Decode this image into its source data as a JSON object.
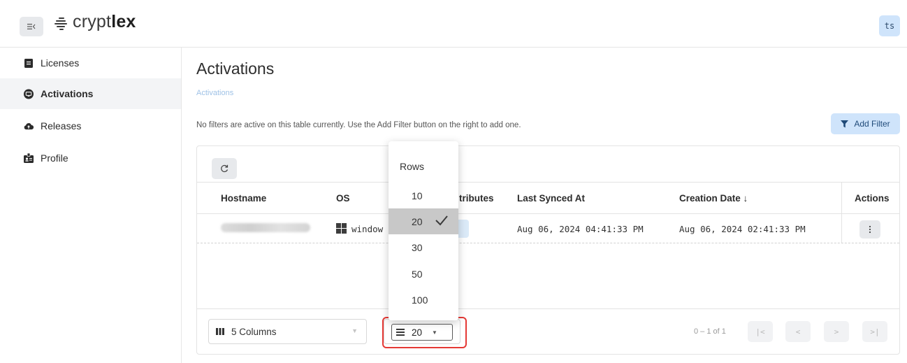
{
  "header": {
    "menu_icon": "collapse-sidebar-icon",
    "logo_prefix": "crypt",
    "logo_bold": "lex",
    "avatar_initials": "ts"
  },
  "sidebar": {
    "items": [
      {
        "label": "Licenses",
        "icon": "document-icon",
        "active": false
      },
      {
        "label": "Activations",
        "icon": "activations-icon",
        "active": true
      },
      {
        "label": "Releases",
        "icon": "cloud-upload-icon",
        "active": false
      },
      {
        "label": "Profile",
        "icon": "id-badge-icon",
        "active": false
      }
    ]
  },
  "main": {
    "title": "Activations",
    "breadcrumb": "Activations",
    "filter_message": "No filters are active on this table currently. Use the Add Filter button on the right to add one.",
    "add_filter_label": "Add Filter"
  },
  "table": {
    "columns": [
      "Hostname",
      "OS",
      "tributes",
      "Last Synced At",
      "Creation Date ↓",
      "Actions"
    ],
    "rows": [
      {
        "hostname_blurred": true,
        "os": "window",
        "last_synced": "Aug 06, 2024 04:41:33 PM",
        "created": "Aug 06, 2024 02:41:33 PM",
        "actions_icon": "more-vertical-icon"
      }
    ]
  },
  "footer": {
    "columns_label": "5 Columns",
    "rows_value": "20",
    "pagination_text": "0 – 1 of 1",
    "pager_buttons": [
      "|<",
      "<",
      ">",
      ">|"
    ]
  },
  "rows_menu": {
    "heading": "Rows",
    "options": [
      "10",
      "20",
      "30",
      "50",
      "100"
    ],
    "selected": "20"
  },
  "colors": {
    "accent_light": "#cfe4fb",
    "highlight_border": "#e53935",
    "selected_option_bg": "#c8c8c8"
  }
}
